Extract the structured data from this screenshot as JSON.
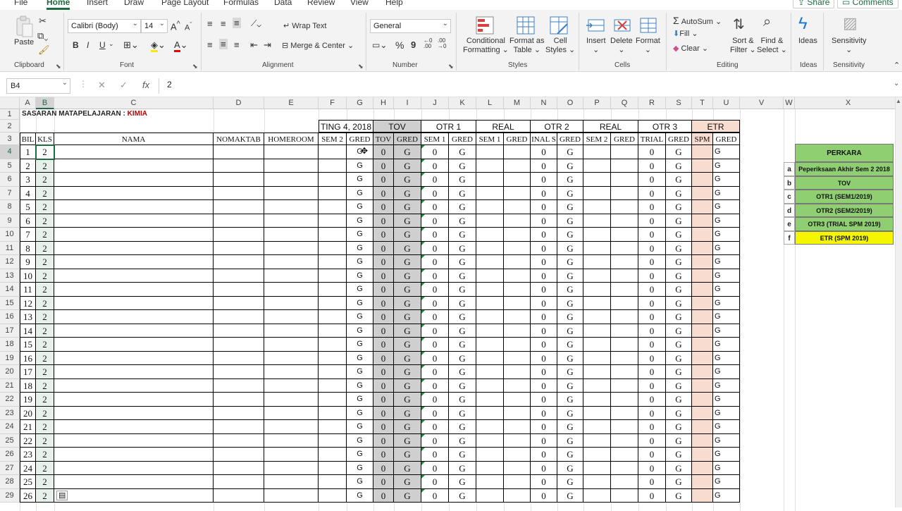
{
  "menu": {
    "tabs": [
      "File",
      "Home",
      "Insert",
      "Draw",
      "Page Layout",
      "Formulas",
      "Data",
      "Review",
      "View",
      "Help"
    ],
    "share": "Share",
    "comments": "Comments"
  },
  "ribbon": {
    "clipboard": {
      "paste": "Paste",
      "label": "Clipboard"
    },
    "font": {
      "name": "Calibri (Body)",
      "size": "14",
      "label": "Font",
      "bold": "B",
      "italic": "I",
      "underline": "U",
      "grow": "A",
      "shrink": "A"
    },
    "alignment": {
      "wrap": "Wrap Text",
      "merge": "Merge & Center",
      "label": "Alignment"
    },
    "number": {
      "format": "General",
      "label": "Number",
      "percent": "%",
      "comma": "9"
    },
    "styles": {
      "conditional": "Conditional",
      "conditional2": "Formatting",
      "format_table": "Format as",
      "format_table2": "Table",
      "cell_styles": "Cell",
      "cell_styles2": "Styles",
      "label": "Styles"
    },
    "cells": {
      "insert": "Insert",
      "delete": "Delete",
      "format": "Format",
      "label": "Cells"
    },
    "editing": {
      "autosum": "AutoSum",
      "fill": "Fill",
      "clear": "Clear",
      "sort": "Sort &",
      "sort2": "Filter",
      "find": "Find &",
      "find2": "Select",
      "label": "Editing"
    },
    "ideas": {
      "button": "Ideas",
      "label": "Ideas"
    },
    "sensitivity": {
      "button": "Sensitivity",
      "label": "Sensitivity"
    }
  },
  "formula_bar": {
    "name_box": "B4",
    "fx": "fx",
    "value": "2"
  },
  "sheet": {
    "columns": [
      "A",
      "B",
      "C",
      "D",
      "E",
      "F",
      "G",
      "H",
      "I",
      "J",
      "K",
      "L",
      "M",
      "N",
      "O",
      "P",
      "Q",
      "R",
      "S",
      "T",
      "U",
      "V",
      "W",
      "X"
    ],
    "title_prefix": "SASARAN MATAPELAJARAN : ",
    "title_subject": "KIMIA",
    "group_headers": [
      "TING 4, 2018",
      "TOV",
      "OTR 1",
      "REAL",
      "OTR 2",
      "REAL",
      "OTR 3",
      "ETR"
    ],
    "sub_headers": {
      "A": "BIL",
      "B": "KLS",
      "C": "NAMA",
      "D": "NOMAKTAB",
      "E": "HOMEROOM",
      "F": "SEM  2",
      "G": "GRED",
      "H": "TOV",
      "I": "GRED",
      "J": "SEM  1",
      "K": "GRED",
      "L": "SEM  1",
      "M": "GRED",
      "N": "INAL  S",
      "O": "GRED",
      "P": "SEM  2",
      "Q": "GRED",
      "R": "TRIAL",
      "S": "GRED",
      "T": "SPM",
      "U": "GRED"
    },
    "rows": [
      {
        "row": "4",
        "bil": "1",
        "kls": "2"
      },
      {
        "row": "5",
        "bil": "2",
        "kls": "2"
      },
      {
        "row": "6",
        "bil": "3",
        "kls": "2"
      },
      {
        "row": "7",
        "bil": "4",
        "kls": "2"
      },
      {
        "row": "8",
        "bil": "5",
        "kls": "2"
      },
      {
        "row": "9",
        "bil": "6",
        "kls": "2"
      },
      {
        "row": "10",
        "bil": "7",
        "kls": "2"
      },
      {
        "row": "11",
        "bil": "8",
        "kls": "2"
      },
      {
        "row": "12",
        "bil": "9",
        "kls": "2"
      },
      {
        "row": "13",
        "bil": "10",
        "kls": "2"
      },
      {
        "row": "14",
        "bil": "11",
        "kls": "2"
      },
      {
        "row": "15",
        "bil": "12",
        "kls": "2"
      },
      {
        "row": "16",
        "bil": "13",
        "kls": "2"
      },
      {
        "row": "17",
        "bil": "14",
        "kls": "2"
      },
      {
        "row": "18",
        "bil": "15",
        "kls": "2"
      },
      {
        "row": "19",
        "bil": "16",
        "kls": "2"
      },
      {
        "row": "20",
        "bil": "17",
        "kls": "2"
      },
      {
        "row": "21",
        "bil": "18",
        "kls": "2"
      },
      {
        "row": "22",
        "bil": "19",
        "kls": "2"
      },
      {
        "row": "23",
        "bil": "20",
        "kls": "2"
      },
      {
        "row": "24",
        "bil": "21",
        "kls": "2"
      },
      {
        "row": "25",
        "bil": "22",
        "kls": "2"
      },
      {
        "row": "26",
        "bil": "23",
        "kls": "2"
      },
      {
        "row": "27",
        "bil": "24",
        "kls": "2"
      },
      {
        "row": "28",
        "bil": "25",
        "kls": "2"
      },
      {
        "row": "29",
        "bil": "26",
        "kls": "2"
      }
    ],
    "values": {
      "gred": "G",
      "zero": "0"
    },
    "perkara": {
      "header": "PERKARA",
      "items": [
        {
          "key": "a",
          "text": "Peperiksaan Akhir Sem 2 2018",
          "color": "#8fcf72"
        },
        {
          "key": "b",
          "text": "TOV",
          "color": "#8fcf72"
        },
        {
          "key": "c",
          "text": "OTR1 (SEM1/2019)",
          "color": "#8fcf72"
        },
        {
          "key": "d",
          "text": "OTR2 (SEM2/2019)",
          "color": "#8fcf72"
        },
        {
          "key": "e",
          "text": "OTR3 (TRIAL SPM 2019)",
          "color": "#8fcf72"
        },
        {
          "key": "f",
          "text": "ETR (SPM 2019)",
          "color": "#f5f500"
        }
      ]
    },
    "colors": {
      "grey_band": "#cfcfcf",
      "pink_band": "#f8dcd0",
      "accent": "#1e6b41"
    }
  }
}
